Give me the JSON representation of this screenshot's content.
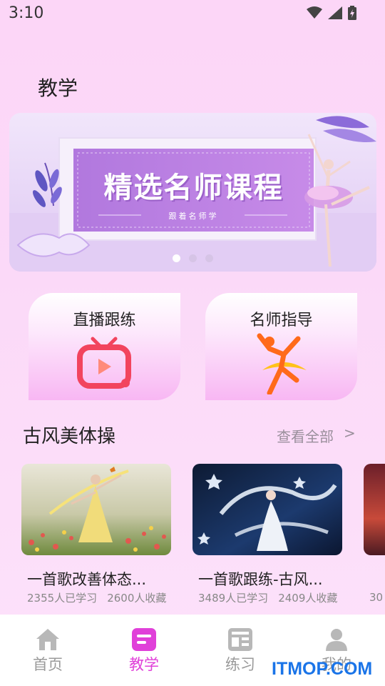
{
  "status_bar": {
    "time": "3:10"
  },
  "page": {
    "title": "教学"
  },
  "banner": {
    "headline": "精选名师课程",
    "subline": "跟着名师学",
    "dots": 3,
    "active_dot": 0
  },
  "feature_cards": [
    {
      "title": "直播跟练",
      "icon": "tv-icon"
    },
    {
      "title": "名师指导",
      "icon": "dancer-icon"
    }
  ],
  "section": {
    "title": "古风美体操",
    "see_all": "查看全部",
    "see_all_arrow": ">"
  },
  "videos": [
    {
      "title": "一首歌改善体态...",
      "learned": "2355人已学习",
      "favorites": "2600人收藏"
    },
    {
      "title": "一首歌跟练-古风...",
      "learned": "3489人已学习",
      "favorites": "2409人收藏"
    }
  ],
  "partial_video": {
    "stats_fragment": "30"
  },
  "tab_bar": {
    "tabs": [
      {
        "label": "首页",
        "icon": "home-icon"
      },
      {
        "label": "教学",
        "icon": "teaching-icon"
      },
      {
        "label": "练习",
        "icon": "practice-icon"
      },
      {
        "label": "我的",
        "icon": "profile-icon"
      }
    ],
    "active_index": 1
  },
  "watermark": "ITMOP.COM",
  "colors": {
    "accent": "#e040d9",
    "background": "#fcd6f7",
    "tv_icon": "#f2445e",
    "dancer_icon": "#ff6a1a"
  }
}
